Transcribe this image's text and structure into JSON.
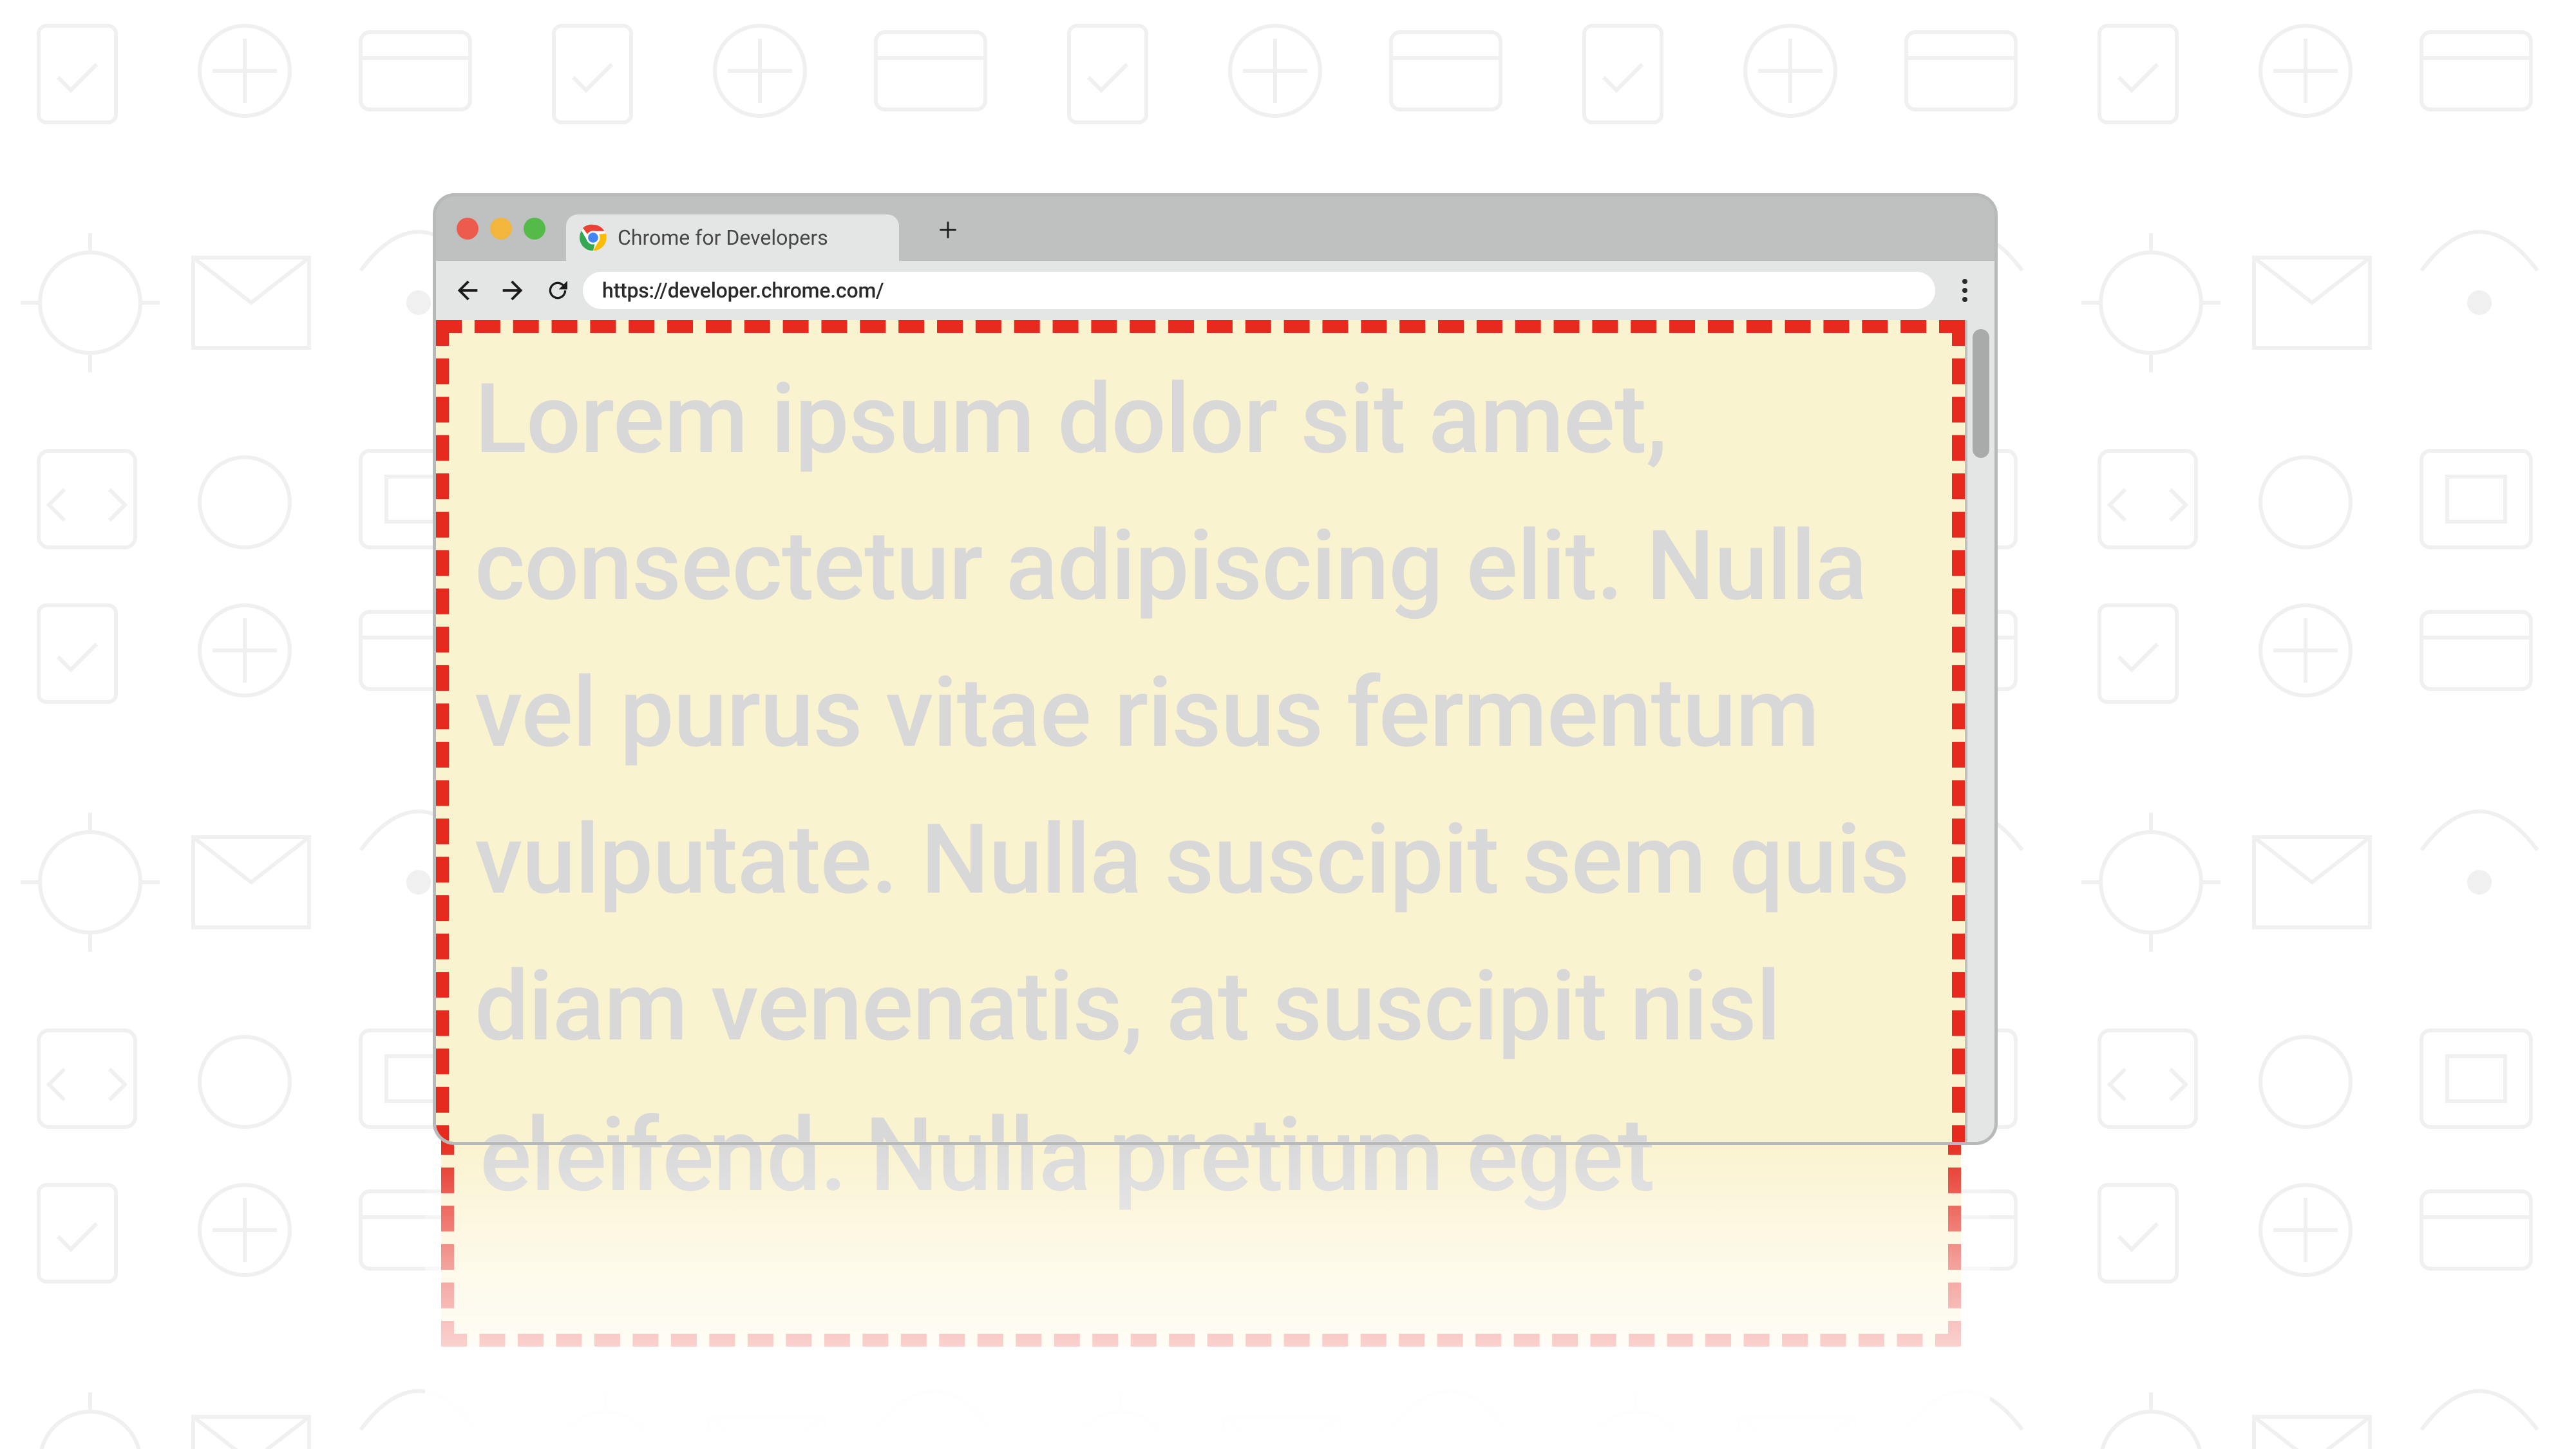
{
  "browser": {
    "tab": {
      "title": "Chrome for Developers"
    },
    "url": "https://developer.chrome.com/",
    "body_text": "Lorem ipsum dolor sit amet, consectetur adipiscing elit. Nulla vel purus vitae risus fermentum vulputate. Nulla suscipit sem quis diam venenatis, at suscipit nisl eleifend. Nulla pretium eget"
  }
}
